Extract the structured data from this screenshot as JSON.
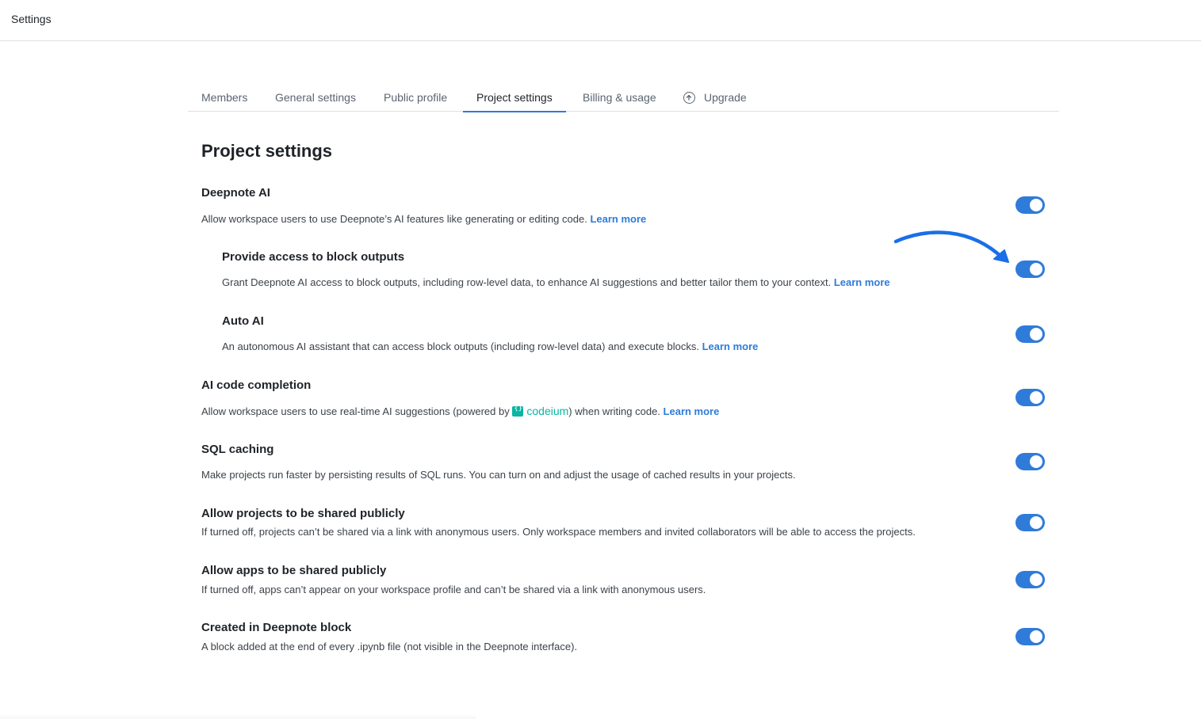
{
  "header": {
    "title": "Settings"
  },
  "tabs": [
    {
      "label": "Members"
    },
    {
      "label": "General settings"
    },
    {
      "label": "Public profile"
    },
    {
      "label": "Project settings"
    },
    {
      "label": "Billing & usage"
    },
    {
      "label": "Upgrade",
      "icon": "arrow-up-circle-icon"
    }
  ],
  "page": {
    "title": "Project settings"
  },
  "settings": [
    {
      "heading": "Deepnote AI",
      "desc": "Allow workspace users to use Deepnote’s AI features like generating or editing code.",
      "link": "Learn more",
      "enabled": true
    },
    {
      "heading": "Provide access to block outputs",
      "desc": "Grant Deepnote AI access to block outputs, including row-level data, to enhance AI suggestions and better tailor them to your context.",
      "link": "Learn more",
      "enabled": true
    },
    {
      "heading": "Auto AI",
      "desc": "An autonomous AI assistant that can access block outputs (including row-level data) and execute blocks.",
      "link": "Learn more",
      "enabled": true
    },
    {
      "heading": "AI code completion",
      "desc_before": "Allow workspace users to use real-time AI suggestions (powered by",
      "brand": "codeium",
      "desc_after": ") when writing code.",
      "link": "Learn more",
      "enabled": true
    },
    {
      "heading": "SQL caching",
      "desc": "Make projects run faster by persisting results of SQL runs. You can turn on and adjust the usage of cached results in your projects.",
      "enabled": true
    },
    {
      "heading": "Allow projects to be shared publicly",
      "desc": "If turned off, projects can’t be shared via a link with anonymous users. Only workspace members and invited collaborators will be able to access the projects.",
      "enabled": true
    },
    {
      "heading": "Allow apps to be shared publicly",
      "desc": "If turned off, apps can’t appear on your workspace profile and can’t be shared via a link with anonymous users.",
      "enabled": true
    },
    {
      "heading": "Created in Deepnote block",
      "desc": "A block added at the end of every .ipynb file (not visible in the Deepnote interface).",
      "enabled": true
    }
  ],
  "colors": {
    "accent": "#2f7bd9",
    "codeium": "#09b6a2",
    "annotation_arrow": "#1a6fe8"
  }
}
